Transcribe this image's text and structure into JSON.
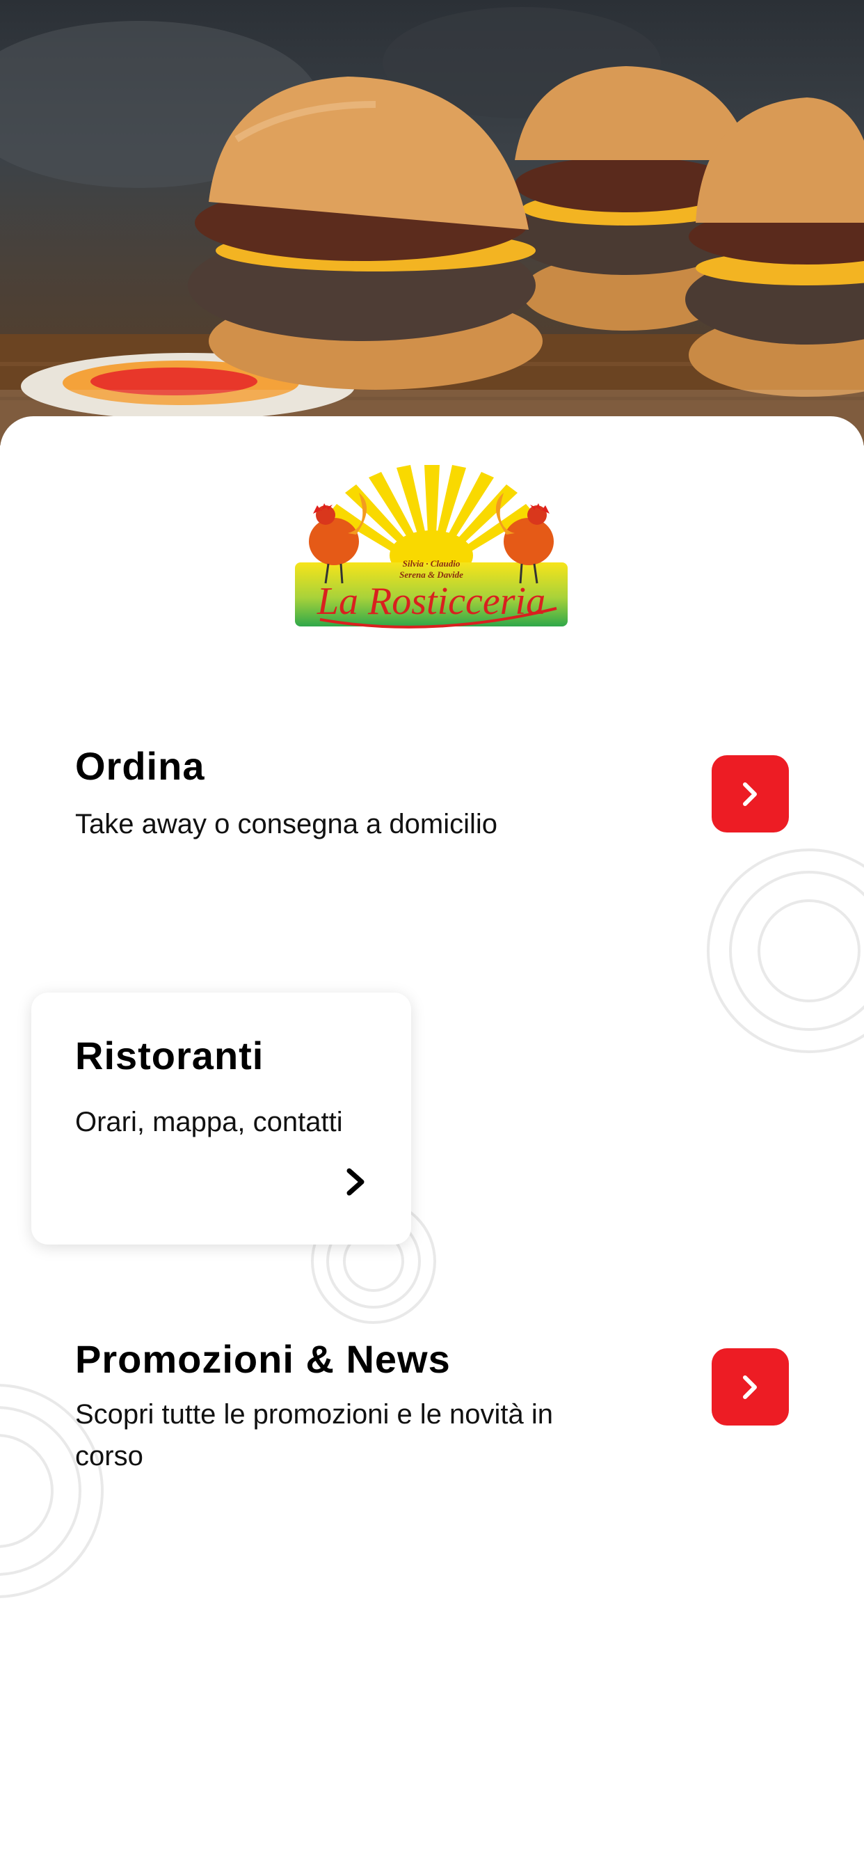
{
  "hero": {
    "image": "burger-photo"
  },
  "logo": {
    "name": "La Rosticceria",
    "script_text": "La Rosticceria",
    "small_text_line1": "Silvia · Claudio",
    "small_text_line2": "Serena & Davide"
  },
  "menu": [
    {
      "title": "Ordina",
      "subtitle": "Take away o consegna a domicilio",
      "button_icon": "chevron-right-icon"
    },
    {
      "title": "Ristoranti",
      "subtitle": "Orari, mappa, contatti",
      "button_icon": "chevron-right-icon"
    },
    {
      "title": "Promozioni & News",
      "subtitle": "Scopri tutte le promozioni e le novità in corso",
      "button_icon": "chevron-right-icon"
    }
  ],
  "colors": {
    "accent": "#ed1c24",
    "text": "#000000",
    "background": "#ffffff"
  }
}
